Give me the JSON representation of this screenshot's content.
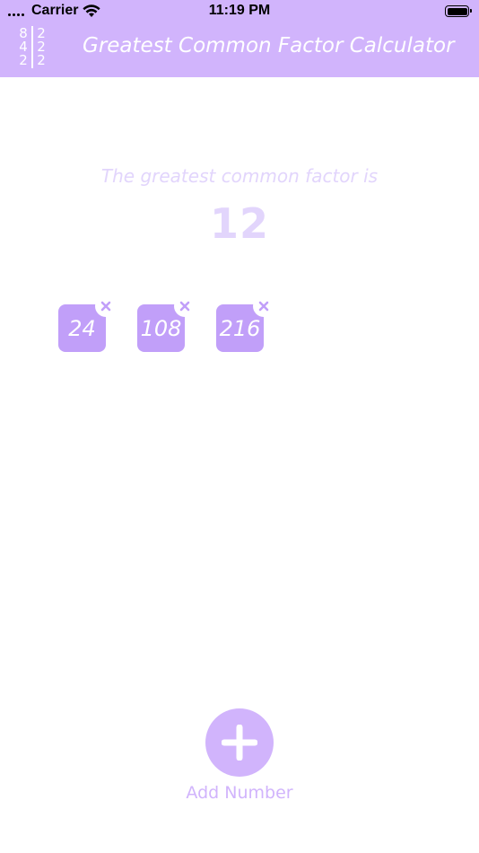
{
  "status_bar": {
    "carrier": "Carrier",
    "time": "11:19 PM"
  },
  "header": {
    "title": "Greatest Common Factor Calculator",
    "logo_digits": [
      "8",
      "2",
      "4",
      "2",
      "2",
      "2"
    ]
  },
  "result": {
    "caption": "The greatest common factor is",
    "value": "12"
  },
  "numbers": [
    "24",
    "108",
    "216"
  ],
  "add_button": {
    "label": "Add Number"
  },
  "colors": {
    "header_bg": "#d1b4fc",
    "chip_bg": "#c19ff9",
    "result_text": "#e2d5fc"
  }
}
